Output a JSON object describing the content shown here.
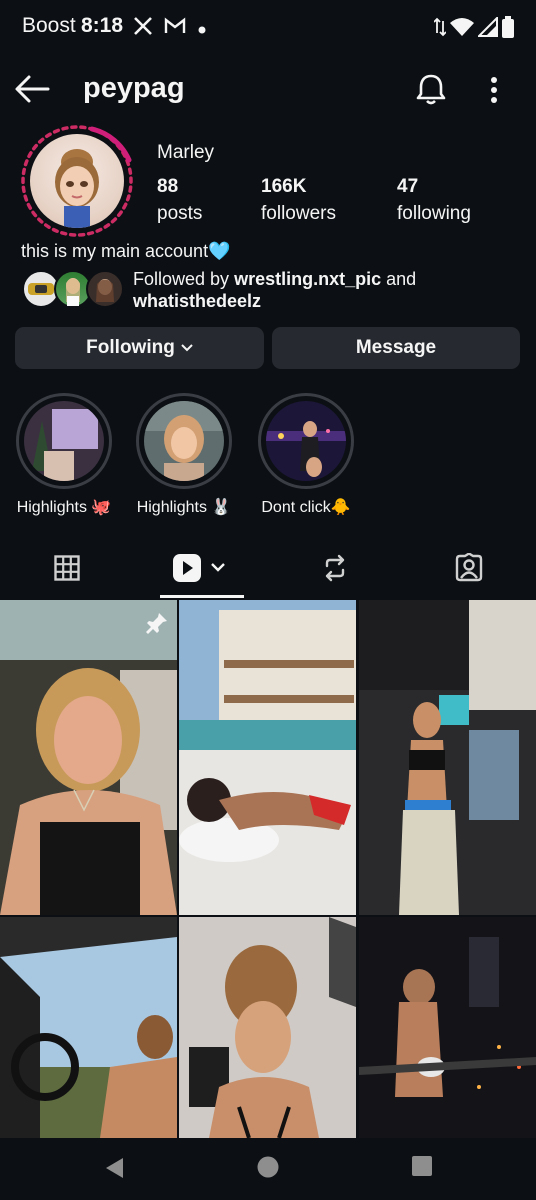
{
  "status": {
    "carrier": "Boost",
    "time": "8:18"
  },
  "profile": {
    "username": "peypag",
    "display_name": "Marley",
    "posts_count": "88",
    "posts_label": "posts",
    "followers_count": "166K",
    "followers_label": "followers",
    "following_count": "47",
    "following_label": "following",
    "bio": "this is my main account🩵",
    "followed_by_prefix": "Followed by ",
    "followed_by_user1": "wrestling.nxt_pic",
    "followed_by_and": " and",
    "followed_by_user2": "whatisthedeelz"
  },
  "actions": {
    "following_label": "Following",
    "message_label": "Message"
  },
  "highlights": [
    {
      "label": "Highlights 🐙"
    },
    {
      "label": "Highlights 🐰"
    },
    {
      "label": "Dont click🐥"
    }
  ],
  "tabs": [
    "grid-icon",
    "reels-icon",
    "reposts-icon",
    "tagged-icon"
  ],
  "colors": {
    "background": "#0c1014",
    "button": "#262a30",
    "story_ring": "#e1306c"
  }
}
